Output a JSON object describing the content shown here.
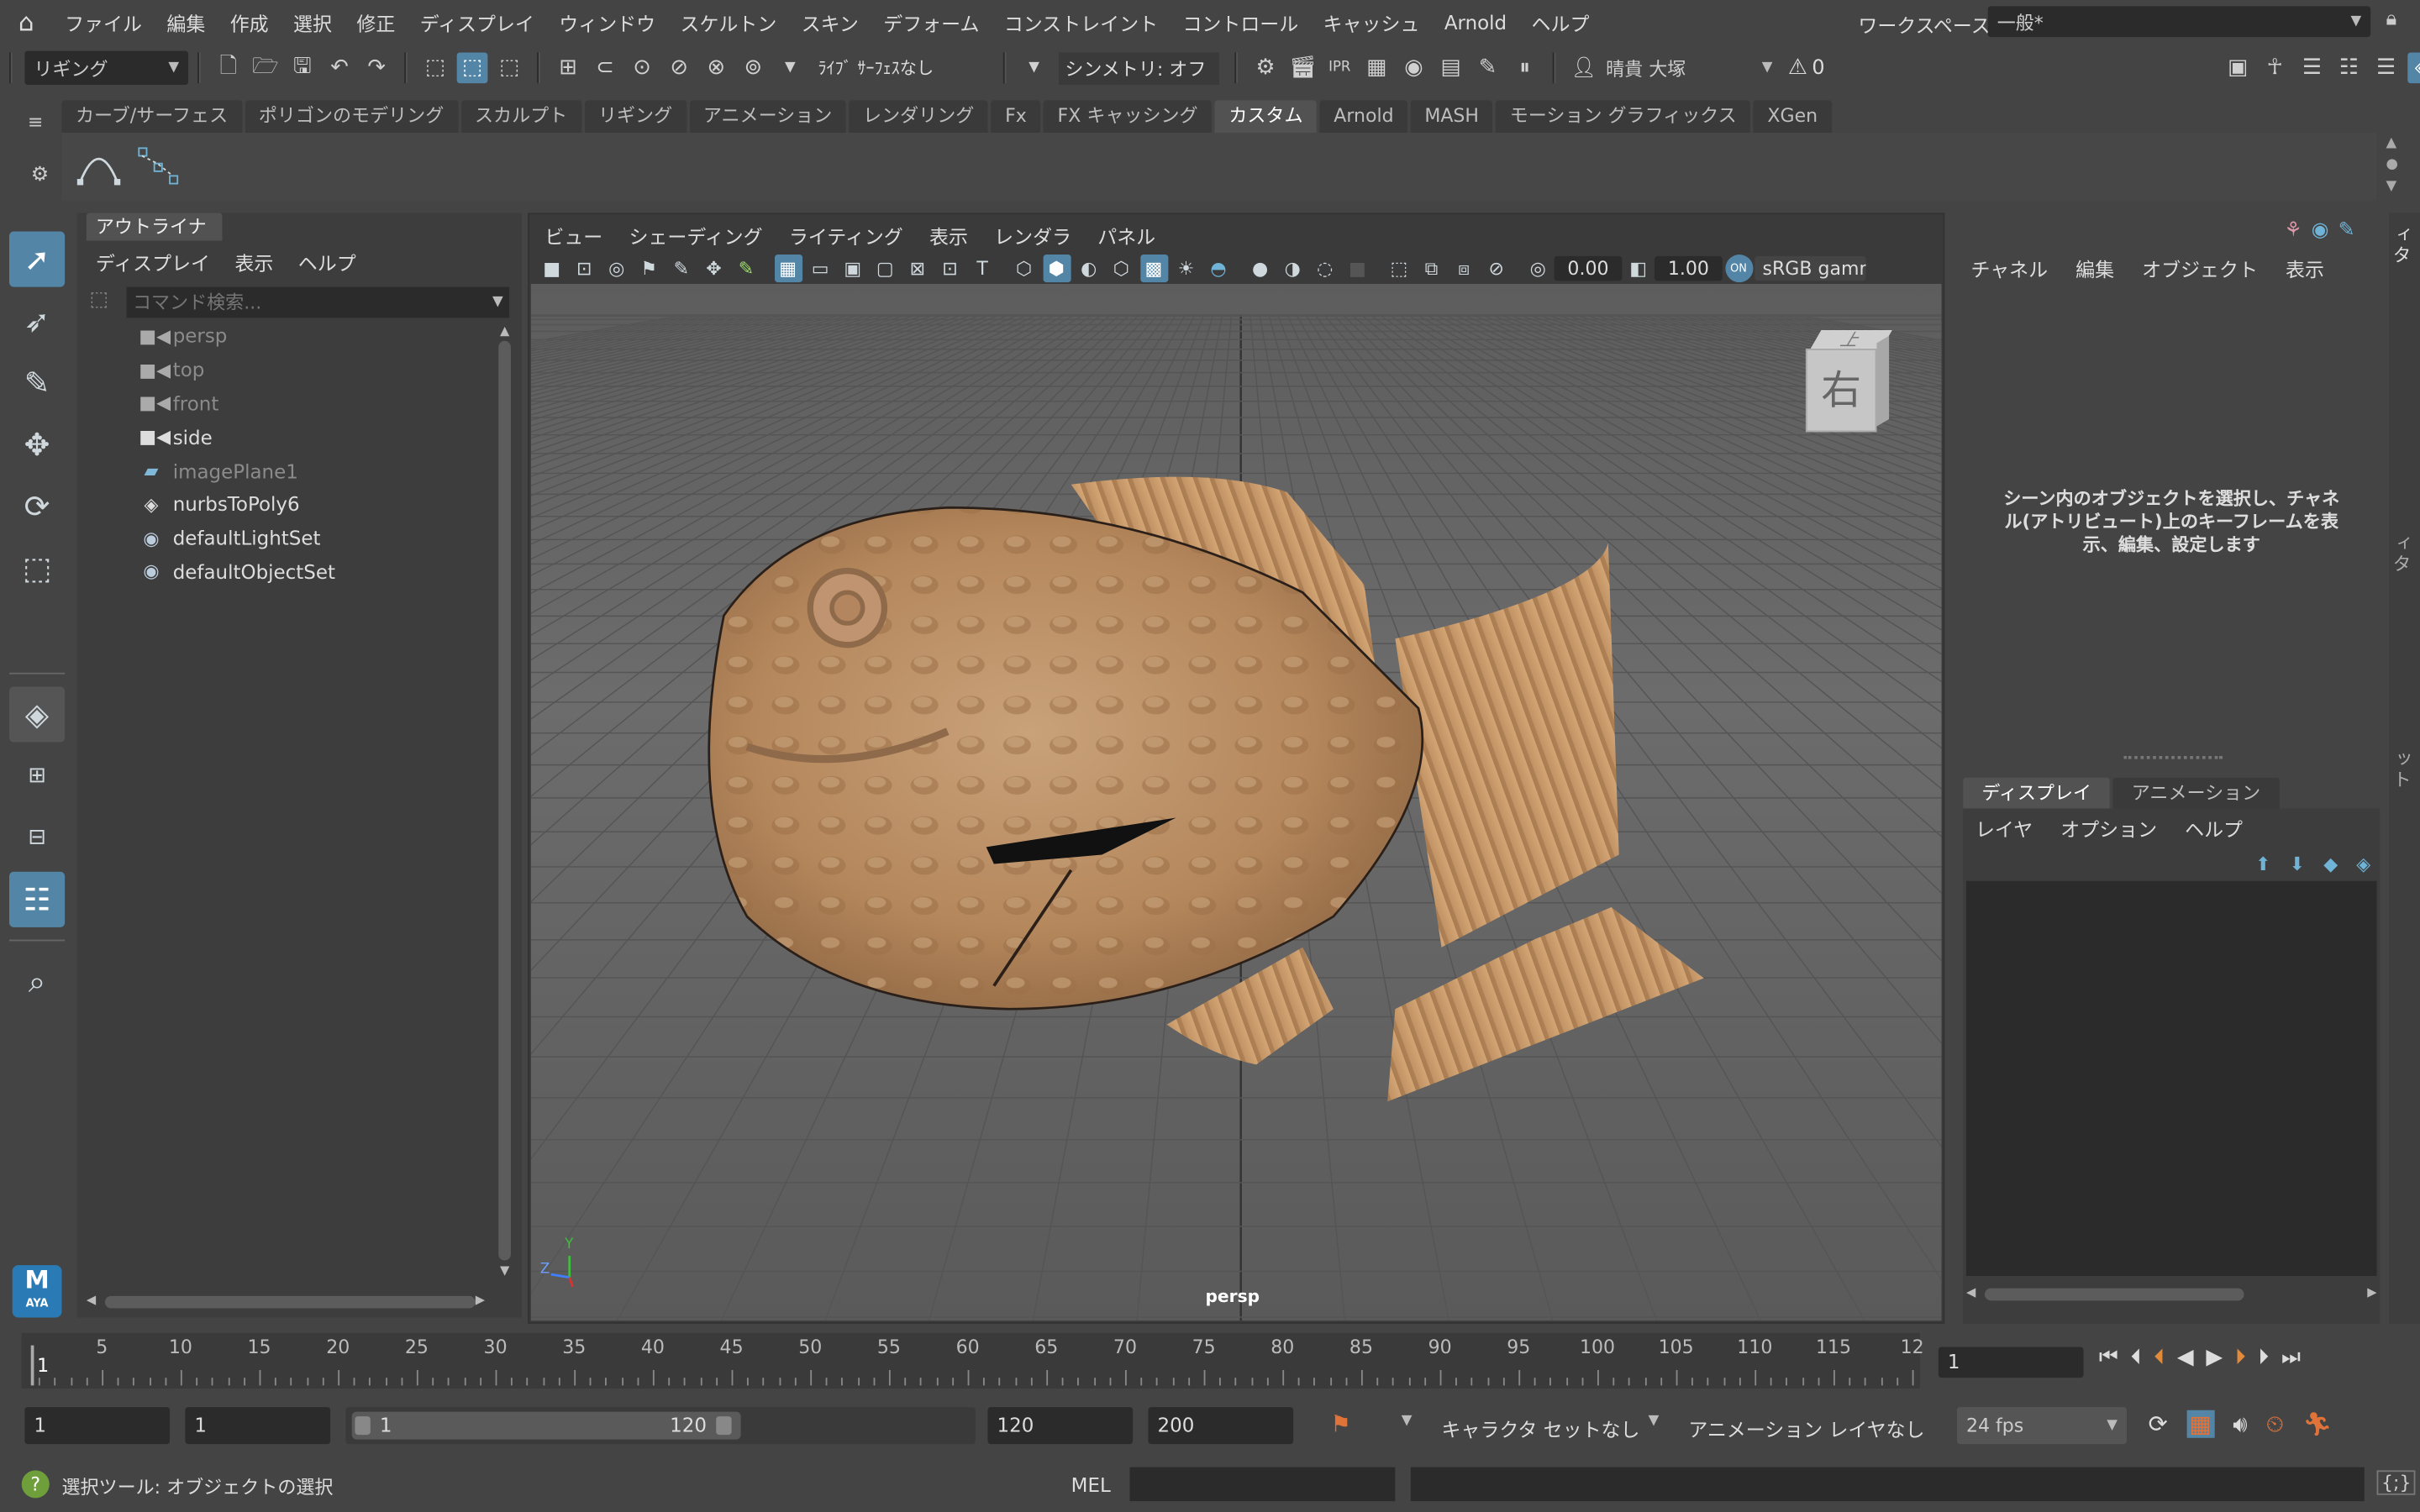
{
  "menubar": {
    "items": [
      "ファイル",
      "編集",
      "作成",
      "選択",
      "修正",
      "ディスプレイ",
      "ウィンドウ",
      "スケルトン",
      "スキン",
      "デフォーム",
      "コンストレイント",
      "コントロール",
      "キャッシュ",
      "Arnold",
      "ヘルプ"
    ],
    "workspace_label": "ワークスペース:",
    "workspace_value": "一般*"
  },
  "toolbar": {
    "mode": "リギング",
    "live_surface": "ﾗｲﾌﾞ ｻｰﾌｪｽなし",
    "symmetry": "シンメトリ: オフ",
    "user": "晴貴 大塚",
    "warnings": "0"
  },
  "shelf": {
    "tabs": [
      "カーブ/サーフェス",
      "ポリゴンのモデリング",
      "スカルプト",
      "リギング",
      "アニメーション",
      "レンダリング",
      "Fx",
      "FX キャッシング",
      "カスタム",
      "Arnold",
      "MASH",
      "モーション グラフィックス",
      "XGen"
    ],
    "active": "カスタム"
  },
  "outliner": {
    "tab": "アウトライナ",
    "menus": [
      "ディスプレイ",
      "表示",
      "ヘルプ"
    ],
    "search_placeholder": "コマンド検索...",
    "items": [
      {
        "label": "persp",
        "icon": "camera-icon",
        "dim": true
      },
      {
        "label": "top",
        "icon": "camera-icon",
        "dim": true
      },
      {
        "label": "front",
        "icon": "camera-icon",
        "dim": true
      },
      {
        "label": "side",
        "icon": "camera-icon",
        "dim": false
      },
      {
        "label": "imagePlane1",
        "icon": "image-plane-icon",
        "dim": true
      },
      {
        "label": "nurbsToPoly6",
        "icon": "mesh-icon",
        "dim": false
      },
      {
        "label": "defaultLightSet",
        "icon": "set-icon",
        "dim": false
      },
      {
        "label": "defaultObjectSet",
        "icon": "set-icon",
        "dim": false
      }
    ]
  },
  "viewport": {
    "menus": [
      "ビュー",
      "シェーディング",
      "ライティング",
      "表示",
      "レンダラ",
      "パネル"
    ],
    "exposure": "0.00",
    "gamma": "1.00",
    "color_space": "sRGB gamm",
    "camera_label": "persp",
    "viewcube_face": "右",
    "viewcube_top": "上",
    "axis_y": "Y",
    "axis_z": "Z"
  },
  "channelbox": {
    "menus": [
      "チャネル",
      "編集",
      "オブジェクト",
      "表示"
    ],
    "hint": "シーン内のオブジェクトを選択し、チャネル(アトリビュート)上のキーフレームを表示、編集、設定します",
    "layer_tabs": [
      "ディスプレイ",
      "アニメーション"
    ],
    "layer_menus": [
      "レイヤ",
      "オプション",
      "ヘルプ"
    ]
  },
  "sidetabs": [
    "チャネル ボックス/レイヤ エディタ",
    "アトリビュート エディタ",
    "モデリング ツールキット"
  ],
  "timeline": {
    "ticks": [
      "5",
      "10",
      "15",
      "20",
      "25",
      "30",
      "35",
      "40",
      "45",
      "50",
      "55",
      "60",
      "65",
      "70",
      "75",
      "80",
      "85",
      "90",
      "95",
      "100",
      "105",
      "110",
      "115",
      "12"
    ],
    "current_marker": "1",
    "current_frame": "1"
  },
  "range": {
    "start": "1",
    "anim_start": "1",
    "slider_start": "1",
    "slider_end": "120",
    "end": "120",
    "anim_end": "200",
    "character_set": "キャラクタ セットなし",
    "anim_layer": "アニメーション レイヤなし",
    "fps": "24 fps"
  },
  "status": {
    "message": "選択ツール: オブジェクトの選択",
    "cmd_lang": "MEL"
  },
  "logo_text": "AYA"
}
